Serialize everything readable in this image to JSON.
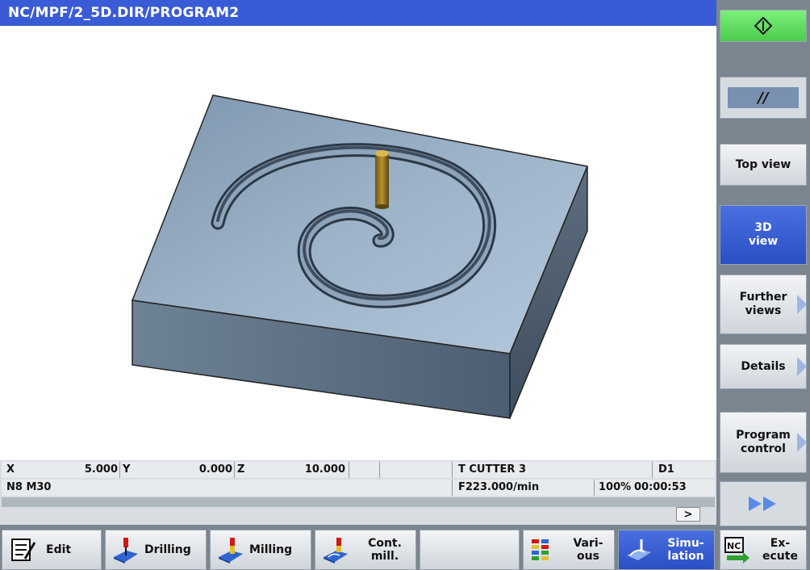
{
  "window": {
    "title": "NC/MPF/2_5D.DIR/PROGRAM2"
  },
  "colors": {
    "title_bar": "#3a5bd6",
    "accent_active": "#2a4fc4",
    "start_green": "#5ddc5d",
    "workpiece": "#8fa7bf"
  },
  "right_softkeys": [
    {
      "label": "",
      "icon": "start-cycle-icon"
    },
    {
      "label": "",
      "icon": "single-block-icon"
    },
    {
      "label": "Top view"
    },
    {
      "label": "3D view",
      "line1": "3D",
      "line2": "view",
      "active": true
    },
    {
      "label": "Further views",
      "line1": "Further",
      "line2": "views",
      "has_submenu": true
    },
    {
      "label": "Details",
      "has_submenu": true
    },
    {
      "label": "Program control",
      "line1": "Program",
      "line2": "control",
      "has_submenu": true
    },
    {
      "label": "",
      "icon": "forward-icon"
    }
  ],
  "status": {
    "x_label": "X",
    "x_value": "5.000",
    "y_label": "Y",
    "y_value": "0.000",
    "z_label": "Z",
    "z_value": "10.000",
    "tool": "T CUTTER 3",
    "d_number": "D1",
    "block": "N8  M30",
    "feed": "F223.000/min",
    "override": "100%",
    "time": "00:00:53",
    "scroll_button": ">"
  },
  "bottom_softkeys": [
    {
      "label": "Edit",
      "icon": "edit-icon"
    },
    {
      "label": "Drilling",
      "icon": "drilling-icon"
    },
    {
      "label": "Milling",
      "icon": "milling-icon"
    },
    {
      "line1": "Cont.",
      "line2": "mill.",
      "icon": "contour-milling-icon"
    },
    {
      "label": ""
    },
    {
      "line1": "Vari-",
      "line2": "ous",
      "icon": "various-icon"
    },
    {
      "line1": "Simu-",
      "line2": "lation",
      "icon": "simulation-icon",
      "active": true
    },
    {
      "line1": "Ex-",
      "line2": "ecute",
      "icon": "nc-execute-icon"
    }
  ]
}
